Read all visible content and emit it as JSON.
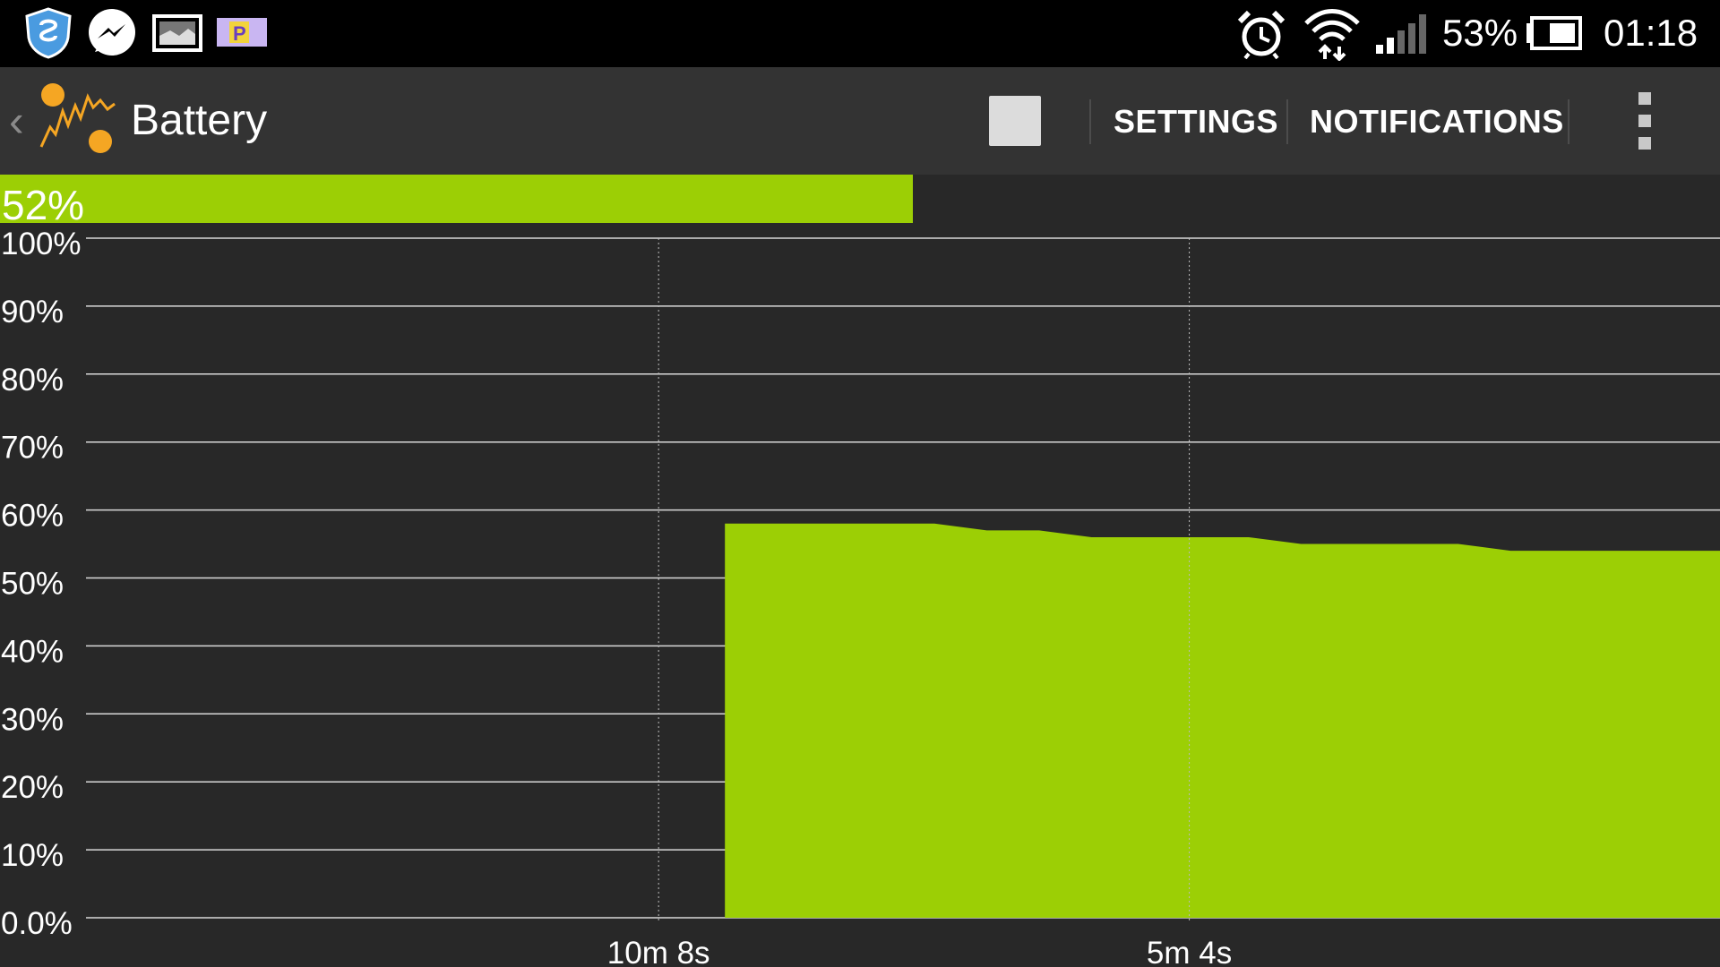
{
  "status_bar": {
    "icons": [
      "shield-icon",
      "messenger-icon",
      "image-icon",
      "parking-app-icon",
      "alarm-icon",
      "wifi-icon",
      "signal-icon",
      "battery-icon"
    ],
    "battery_percent": "53%",
    "time": "01:18"
  },
  "action_bar": {
    "back_glyph": "‹",
    "app_icon": "battery-monitor-logo-icon",
    "title": "Battery",
    "settings_label": "SETTINGS",
    "notifications_label": "NOTIFICATIONS",
    "overflow_icon": "overflow-menu-icon"
  },
  "level_bar": {
    "label": "52%",
    "fraction": 0.52,
    "color": "#9ccf05"
  },
  "chart_data": {
    "type": "area",
    "title": "",
    "xlabel": "",
    "ylabel": "",
    "ylim": [
      0,
      100
    ],
    "y_tick_labels": [
      "0.0%",
      "10%",
      "20%",
      "30%",
      "40%",
      "50%",
      "60%",
      "70%",
      "80%",
      "90%",
      "100%"
    ],
    "y_ticks": [
      0,
      10,
      20,
      30,
      40,
      50,
      60,
      70,
      80,
      90,
      100
    ],
    "xlim_seconds_ago": [
      936,
      0
    ],
    "x_ticks": [
      {
        "label": "10m 8s",
        "seconds_ago": 608
      },
      {
        "label": "5m 4s",
        "seconds_ago": 304
      }
    ],
    "grid": true,
    "fill_color": "#9ccf05",
    "series": [
      {
        "points": [
          {
            "seconds_ago": 570,
            "level": 0
          },
          {
            "seconds_ago": 570,
            "level": 58
          },
          {
            "seconds_ago": 450,
            "level": 58
          },
          {
            "seconds_ago": 420,
            "level": 57
          },
          {
            "seconds_ago": 390,
            "level": 57
          },
          {
            "seconds_ago": 360,
            "level": 56
          },
          {
            "seconds_ago": 270,
            "level": 56
          },
          {
            "seconds_ago": 240,
            "level": 55
          },
          {
            "seconds_ago": 150,
            "level": 55
          },
          {
            "seconds_ago": 120,
            "level": 54
          },
          {
            "seconds_ago": 0,
            "level": 54
          },
          {
            "seconds_ago": 0,
            "level": 0
          }
        ]
      }
    ]
  }
}
